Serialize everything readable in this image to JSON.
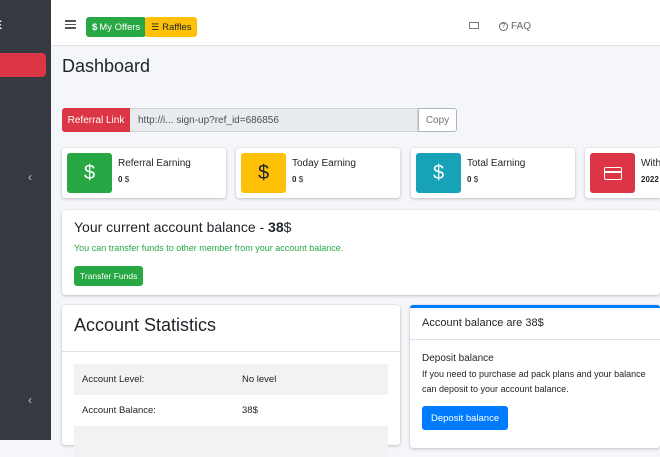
{
  "sidebar": {
    "brand_text": "E",
    "chevron_1": "‹",
    "chevron_2": "‹"
  },
  "topbar": {
    "offers_label": "My Offers",
    "raffles_label": "Raffles",
    "faq_label": "FAQ"
  },
  "page": {
    "title": "Dashboard"
  },
  "referral": {
    "label": "Referral Link",
    "url": "http://i...              sign-up?ref_id=686856",
    "copy_label": "Copy"
  },
  "info_boxes": [
    {
      "title": "Referral Earning",
      "value": "0",
      "unit": "$",
      "icon": "dollar-icon",
      "color": "#28a745"
    },
    {
      "title": "Today Earning",
      "value": "0",
      "unit": "$",
      "icon": "dollar-icon",
      "color": "#ffc107"
    },
    {
      "title": "Total Earning",
      "value": "0",
      "unit": "$",
      "icon": "dollar-icon",
      "color": "#17a2b8"
    },
    {
      "title": "With",
      "value": "2022",
      "unit": "",
      "icon": "credit-card-icon",
      "color": "#dc3545"
    }
  ],
  "balance": {
    "title_prefix": "Your current account balance - ",
    "amount": "38",
    "currency": "$",
    "note": "You can transfer funds to other member from your account balance.",
    "transfer_label": "Transfer Funds"
  },
  "stats": {
    "title": "Account Statistics",
    "rows": [
      {
        "label": "Account Level:",
        "value": "No level"
      },
      {
        "label": "Account Balance:",
        "value": "38$"
      }
    ]
  },
  "deposit": {
    "header": "Account balance are 38$",
    "subtitle": "Deposit balance",
    "text": "If you need to purchase ad pack plans and your balance can deposit to your account balance.",
    "button_label": "Deposit balance"
  },
  "colors": {
    "accent_blue": "#007bff",
    "danger": "#dc3545",
    "success": "#28a745",
    "warning": "#ffc107",
    "info": "#17a2b8"
  }
}
